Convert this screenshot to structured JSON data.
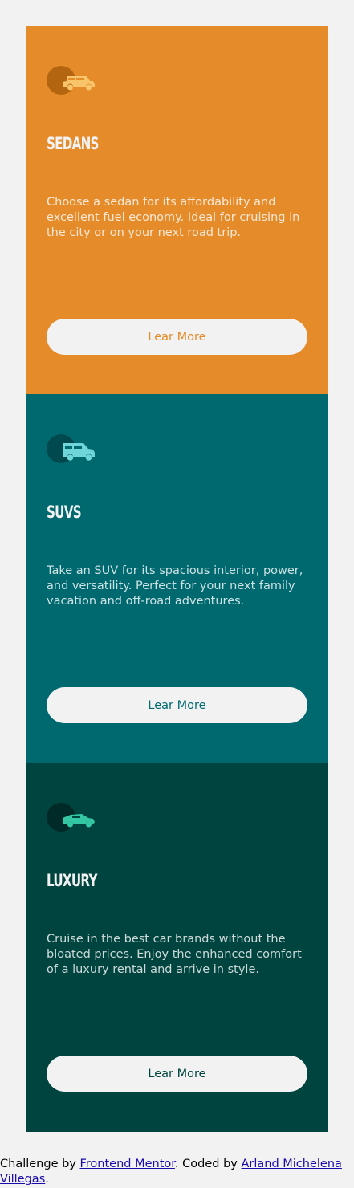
{
  "cards": [
    {
      "title": "SEDANS",
      "description": "Choose a sedan for its affordability and excellent fuel economy. Ideal for cruising in the city or on your next road trip.",
      "button_label": "Lear More",
      "icon": "sedan-car-icon",
      "color": "#e58b29"
    },
    {
      "title": "SUVS",
      "description": "Take an SUV for its spacious interior, power, and versatility. Perfect for your next family vacation and off-road adventures.",
      "button_label": "Lear More",
      "icon": "suv-car-icon",
      "color": "#006970"
    },
    {
      "title": "LUXURY",
      "description": "Cruise in the best car brands without the bloated prices. Enjoy the enhanced comfort of a luxury rental and arrive in style.",
      "button_label": "Lear More",
      "icon": "luxury-car-icon",
      "color": "#00443f"
    }
  ],
  "attribution": {
    "prefix": "Challenge by ",
    "challenge_link": "Frontend Mentor",
    "middle": ". Coded by ",
    "author_link": "Arland Michelena Villegas",
    "suffix": "."
  },
  "colors": {
    "background": "#f2f2f2",
    "button_bg": "#f2f2f2",
    "link": "#1a0dab"
  }
}
